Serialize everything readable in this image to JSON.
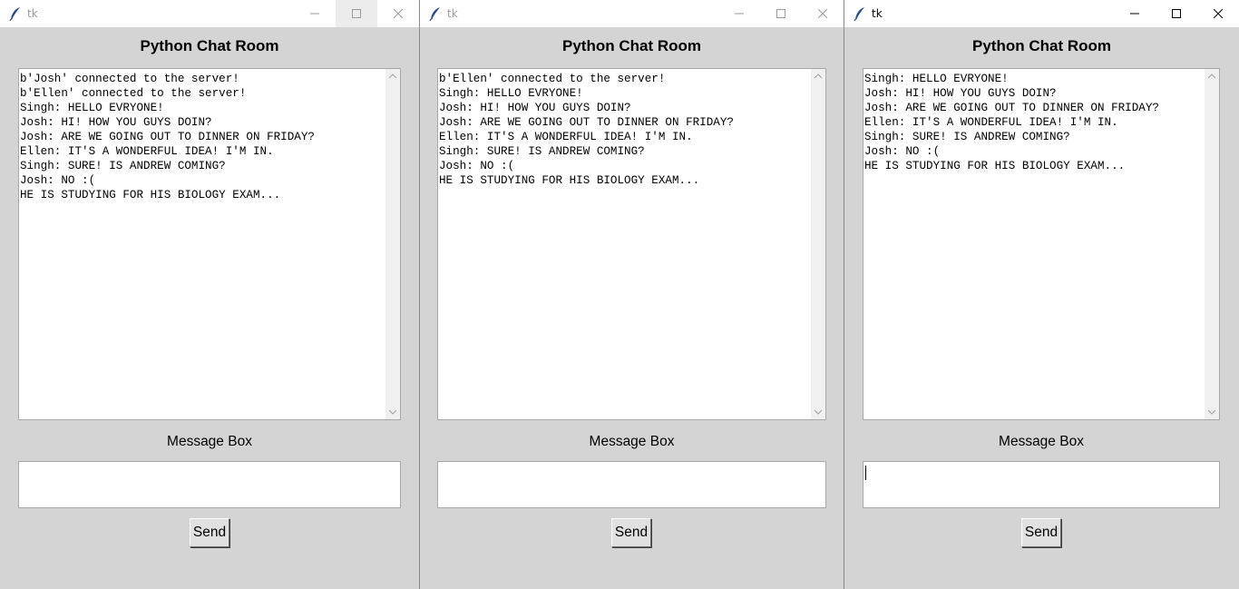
{
  "windows": [
    {
      "title": "tk",
      "app_title": "Python Chat Room",
      "messages": [
        "b'Josh' connected to the server!",
        "b'Ellen' connected to the server!",
        "Singh: HELLO EVRYONE!",
        "Josh: HI! HOW YOU GUYS DOIN?",
        "Josh: ARE WE GOING OUT TO DINNER ON FRIDAY?",
        "Ellen: IT'S A WONDERFUL IDEA! I'M IN.",
        "Singh: SURE! IS ANDREW COMING?",
        "Josh: NO :(",
        "HE IS STUDYING FOR HIS BIOLOGY EXAM..."
      ],
      "message_label": "Message Box",
      "message_value": "",
      "send_label": "Send"
    },
    {
      "title": "tk",
      "app_title": "Python Chat Room",
      "messages": [
        "b'Ellen' connected to the server!",
        "Singh: HELLO EVRYONE!",
        "Josh: HI! HOW YOU GUYS DOIN?",
        "Josh: ARE WE GOING OUT TO DINNER ON FRIDAY?",
        "Ellen: IT'S A WONDERFUL IDEA! I'M IN.",
        "Singh: SURE! IS ANDREW COMING?",
        "Josh: NO :(",
        "HE IS STUDYING FOR HIS BIOLOGY EXAM..."
      ],
      "message_label": "Message Box",
      "message_value": "",
      "send_label": "Send"
    },
    {
      "title": "tk",
      "app_title": "Python Chat Room",
      "messages": [
        "Singh: HELLO EVRYONE!",
        "Josh: HI! HOW YOU GUYS DOIN?",
        "Josh: ARE WE GOING OUT TO DINNER ON FRIDAY?",
        "Ellen: IT'S A WONDERFUL IDEA! I'M IN.",
        "Singh: SURE! IS ANDREW COMING?",
        "Josh: NO :(",
        "HE IS STUDYING FOR HIS BIOLOGY EXAM..."
      ],
      "message_label": "Message Box",
      "message_value": "",
      "send_label": "Send"
    }
  ],
  "icons": {
    "app": "feather-icon",
    "minimize": "minimize-icon",
    "maximize": "maximize-icon",
    "close": "close-icon",
    "scroll_up": "chevron-up-icon",
    "scroll_down": "chevron-down-icon"
  },
  "colors": {
    "window_bg": "#d4d4d4",
    "titlebar_bg": "#ffffff",
    "inactive_title": "#9a9a9a",
    "active_title": "#000000"
  }
}
